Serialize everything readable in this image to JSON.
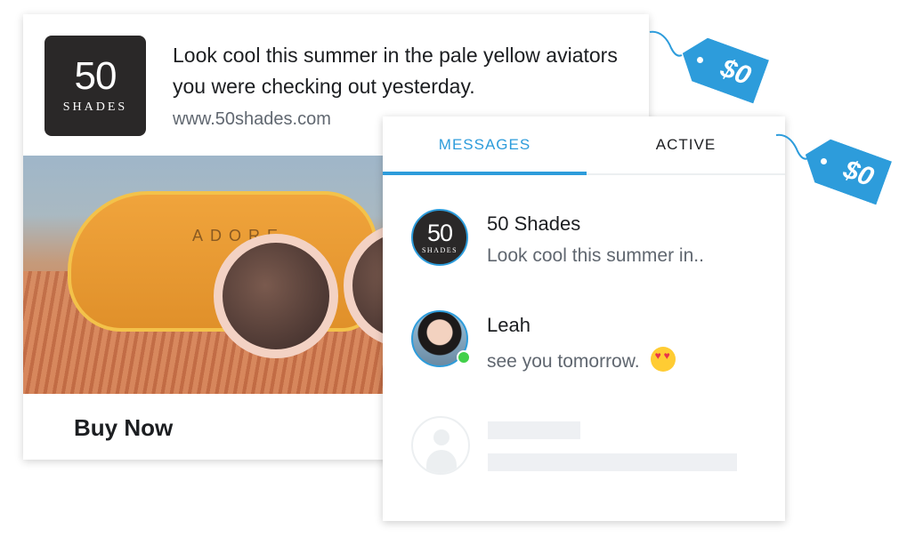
{
  "ad": {
    "brand_logo": {
      "number": "50",
      "word": "SHADES"
    },
    "headline": "Look cool this summer in the pale yellow aviators you were checking out yesterday.",
    "url": "www.50shades.com",
    "product_image": {
      "case_label": "ADORE"
    },
    "cta_label": "Buy Now"
  },
  "messenger": {
    "tabs": [
      {
        "label": "MESSAGES",
        "selected": true
      },
      {
        "label": "ACTIVE",
        "selected": false
      }
    ],
    "conversations": [
      {
        "name": "50 Shades",
        "preview": "Look cool this summer in..",
        "avatar": {
          "number": "50",
          "word": "SHADES"
        },
        "online": false
      },
      {
        "name": "Leah",
        "preview": "see you tomorrow.",
        "emoji": "heart-eyes-emoji",
        "online": true
      }
    ],
    "placeholder": {
      "icon": "user-placeholder-icon"
    }
  },
  "price_tags": [
    {
      "label": "$0"
    },
    {
      "label": "$0"
    }
  ],
  "colors": {
    "accent": "#2d9cdb",
    "online": "#42d04a",
    "text_primary": "#1c1e21",
    "text_secondary": "#606770",
    "logo_bg": "#2a2828"
  }
}
